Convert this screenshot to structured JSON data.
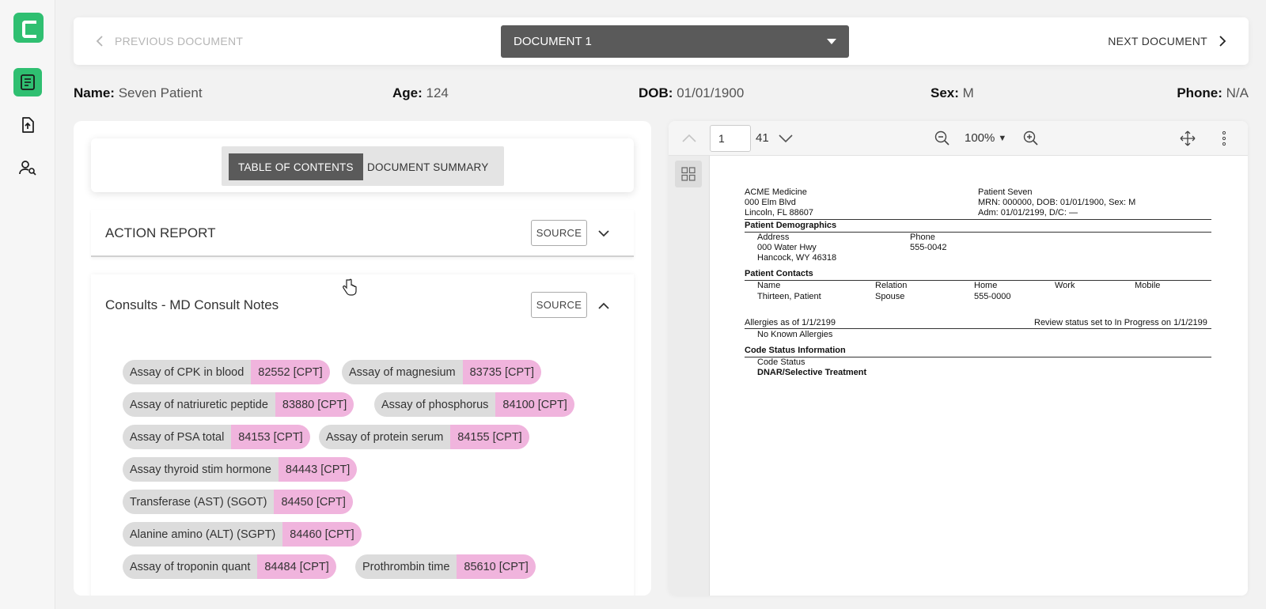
{
  "nav": {
    "prev_label": "PREVIOUS DOCUMENT",
    "next_label": "NEXT DOCUMENT",
    "document_selected": "DOCUMENT 1"
  },
  "patient": {
    "name_label": "Name:",
    "name": "Seven Patient",
    "age_label": "Age:",
    "age": "124",
    "dob_label": "DOB:",
    "dob": "01/01/1900",
    "sex_label": "Sex:",
    "sex": "M",
    "phone_label": "Phone:",
    "phone": "N/A"
  },
  "tabs": {
    "toc": "TABLE OF CONTENTS",
    "summary": "DOCUMENT SUMMARY"
  },
  "sections": {
    "action_report": {
      "title": "ACTION REPORT",
      "source": "SOURCE"
    },
    "consults": {
      "title": "Consults - MD Consult Notes",
      "source": "SOURCE"
    }
  },
  "codes": [
    {
      "name": "Assay of CPK in blood",
      "code": "82552 [CPT]"
    },
    {
      "name": "Assay of magnesium",
      "code": "83735 [CPT]"
    },
    {
      "name": "Assay of natriuretic peptide",
      "code": "83880 [CPT]"
    },
    {
      "name": "Assay of phosphorus",
      "code": "84100 [CPT]"
    },
    {
      "name": "Assay of PSA total",
      "code": "84153 [CPT]"
    },
    {
      "name": "Assay of protein serum",
      "code": "84155 [CPT]"
    },
    {
      "name": "Assay thyroid stim hormone",
      "code": "84443 [CPT]"
    },
    {
      "name": "Transferase (AST) (SGOT)",
      "code": "84450 [CPT]"
    },
    {
      "name": "Alanine amino (ALT) (SGPT)",
      "code": "84460 [CPT]"
    },
    {
      "name": "Assay of troponin quant",
      "code": "84484 [CPT]"
    },
    {
      "name": "Prothrombin time",
      "code": "85610 [CPT]"
    }
  ],
  "viewer": {
    "page": "1",
    "total_pages": "41",
    "zoom": "100%",
    "zoom_caret": "▼"
  },
  "document": {
    "facility_name": "ACME Medicine",
    "facility_addr1": "000 Elm Blvd",
    "facility_addr2": "Lincoln, FL 88607",
    "patient_name": "Patient Seven",
    "patient_mrn": "MRN: 000000, DOB: 01/01/1900, Sex: M",
    "patient_adm": "Adm: 01/01/2199, D/C: —",
    "demographics_title": "Patient Demographics",
    "address_label": "Address",
    "address1": "000 Water Hwy",
    "address2": "Hancock, WY 46318",
    "phone_label": "Phone",
    "phone": "555-0042",
    "contacts_title": "Patient Contacts",
    "contacts_headers": [
      "Name",
      "Relation",
      "Home",
      "Work",
      "Mobile"
    ],
    "contact_name": "Thirteen, Patient",
    "contact_relation": "Spouse",
    "contact_home": "555-0000",
    "allergies_title": "Allergies as of 1/1/2199",
    "allergies_status": "Review status set to In Progress on 1/1/2199",
    "allergies_value": "No Known Allergies",
    "code_status_title": "Code Status Information",
    "code_status_label": "Code Status",
    "code_status_value": "DNAR/Selective Treatment"
  },
  "colors": {
    "brand": "#2fbf71",
    "dark_select": "#5a5a5a",
    "code_pill": "#f0b4dd",
    "name_pill": "#dcdcdc"
  }
}
